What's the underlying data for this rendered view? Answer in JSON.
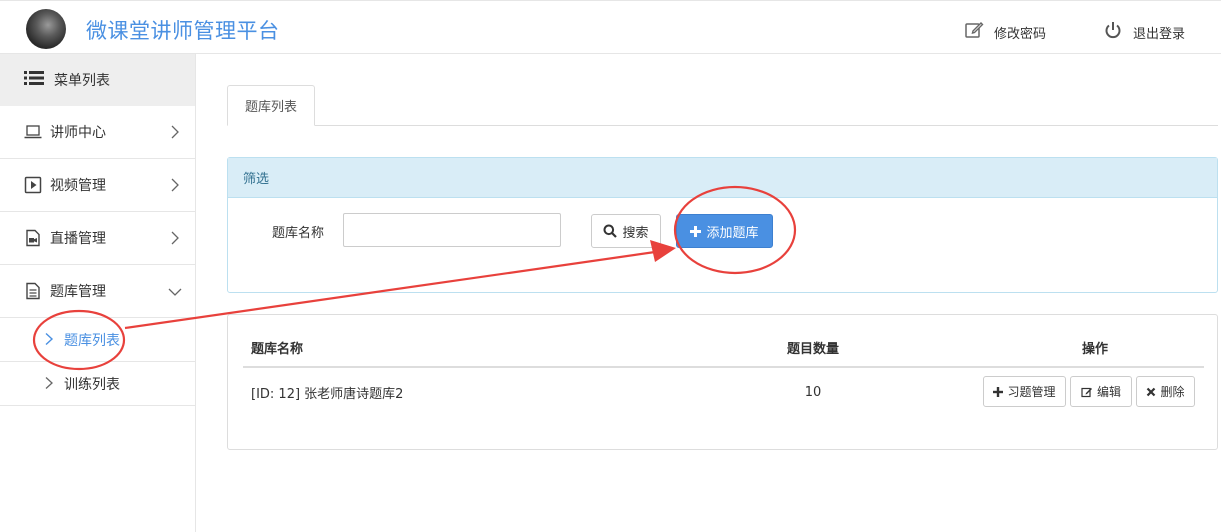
{
  "header": {
    "app_title": "微课堂讲师管理平台",
    "change_password": "修改密码",
    "logout": "退出登录"
  },
  "sidebar": {
    "menu_title": "菜单列表",
    "items": [
      {
        "label": "讲师中心",
        "icon": "laptop-icon",
        "expanded": false
      },
      {
        "label": "视频管理",
        "icon": "play-square-icon",
        "expanded": false
      },
      {
        "label": "直播管理",
        "icon": "video-file-icon",
        "expanded": false
      },
      {
        "label": "题库管理",
        "icon": "document-icon",
        "expanded": true
      }
    ],
    "sub_items": [
      {
        "label": "题库列表",
        "active": true
      },
      {
        "label": "训练列表",
        "active": false
      }
    ]
  },
  "main": {
    "tab_label": "题库列表",
    "filter": {
      "title": "筛选",
      "name_label": "题库名称",
      "name_value": "",
      "name_placeholder": "",
      "search_button": "搜索",
      "add_button": "添加题库"
    },
    "table": {
      "headers": [
        "题库名称",
        "题目数量",
        "操作"
      ],
      "rows": [
        {
          "name": "[ID: 12] 张老师唐诗题库2",
          "count": "10"
        }
      ],
      "actions": [
        "习题管理",
        "编辑",
        "删除"
      ]
    }
  },
  "colors": {
    "accent": "#4a90e2",
    "filter_header_bg": "#d9edf7",
    "annotation_red": "#e8413c"
  }
}
